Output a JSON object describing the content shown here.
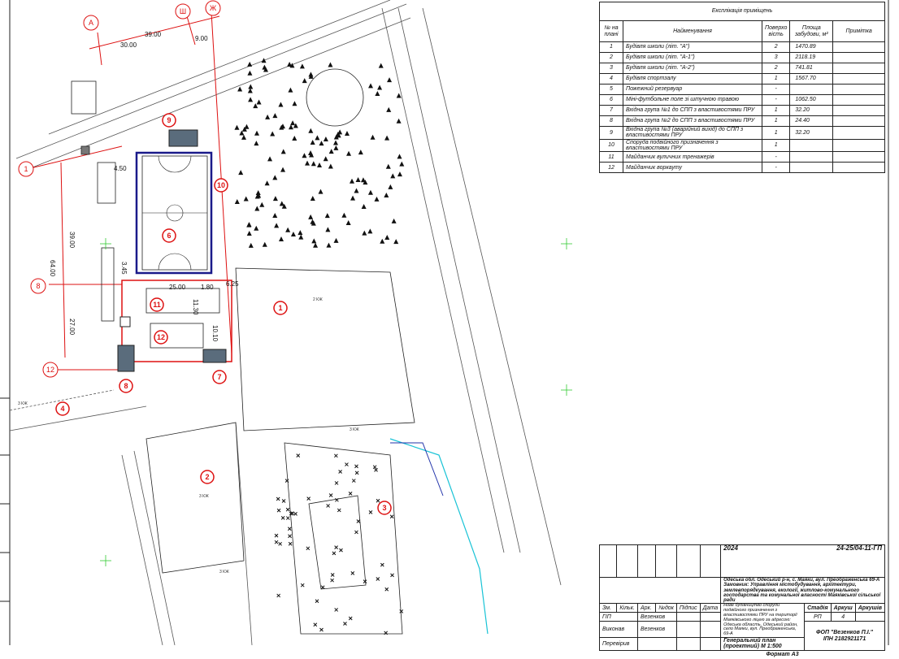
{
  "explication": {
    "title": "Експлікація приміщень",
    "headers": [
      "№ на плані",
      "Найменування",
      "Поверхо вість",
      "Площа забудови, м²",
      "Примітка"
    ],
    "rows": [
      {
        "n": "1",
        "name": "Будівля школи (літ. \"А\")",
        "floors": "2",
        "area": "1470.89",
        "note": ""
      },
      {
        "n": "2",
        "name": "Будівля школи (літ. \"А-1\")",
        "floors": "3",
        "area": "2118.19",
        "note": ""
      },
      {
        "n": "3",
        "name": "Будівля школи (літ. \"А-2\")",
        "floors": "2",
        "area": "741.81",
        "note": ""
      },
      {
        "n": "4",
        "name": "Будівля спортзалу",
        "floors": "1",
        "area": "1567.70",
        "note": ""
      },
      {
        "n": "5",
        "name": "Пожежний резервуар",
        "floors": "-",
        "area": "",
        "note": ""
      },
      {
        "n": "6",
        "name": "Міні-футбольне поле зі штучною травою",
        "floors": "-",
        "area": "1062.50",
        "note": ""
      },
      {
        "n": "7",
        "name": "Вхідна група №1 до СПП з властивостями ПРУ",
        "floors": "1",
        "area": "32.20",
        "note": ""
      },
      {
        "n": "8",
        "name": "Вхідна група №2 до СПП з властивостями ПРУ",
        "floors": "1",
        "area": "24.40",
        "note": ""
      },
      {
        "n": "9",
        "name": "Вхідна група №3 (аварійний вихід) до СПП з властивостями ПРУ",
        "floors": "1",
        "area": "32.20",
        "note": ""
      },
      {
        "n": "10",
        "name": "Споруда подвійного призначення з властивостями ПРУ",
        "floors": "1",
        "area": "",
        "note": ""
      },
      {
        "n": "11",
        "name": "Майданчик вуличних тренажерів",
        "floors": "-",
        "area": "",
        "note": ""
      },
      {
        "n": "12",
        "name": "Майданчик воркауту",
        "floors": "-",
        "area": "",
        "note": ""
      }
    ]
  },
  "stamp": {
    "year": "2024",
    "code": "24-25/04-11-ГП",
    "address": "Одеська обл. Одеський р-н, с. Маяки, вул. Преображенська 69-А",
    "customer": "Замовник: Управління містобудування, архітектури, землевпорядкування, екології, житлово-комунального господарства та комунальної власності Маяківської сільської ради",
    "col_headers": [
      "Зм.",
      "Кільк.",
      "Арк.",
      "№док",
      "Підпис",
      "Дата"
    ],
    "roles": [
      {
        "role": "ГІП",
        "name": "Везенков"
      },
      {
        "role": "Виконав",
        "name": "Везенков"
      },
      {
        "role": "Перевірив",
        "name": ""
      }
    ],
    "object": "Нове будівництво споруди подвійного призначення з властивостями ПРУ на території Маяківського ліцею за адресою: Одеська область, Одеський район, село Маяки, вул. Преображенська, 69-А",
    "stage_headers": [
      "Стадія",
      "Аркуш",
      "Аркушів"
    ],
    "stage": "РП",
    "sheet": "4",
    "sheets": "",
    "drawing": "Генеральний план (проектний) М 1:500",
    "company": "ФОП \"Везенков П.І.\"",
    "company_id": "ІПН 2182921171",
    "format": "Формат А3"
  },
  "plan": {
    "markers": [
      "1",
      "2",
      "3",
      "4",
      "6",
      "7",
      "8",
      "9",
      "10",
      "11",
      "12"
    ],
    "axes": [
      "А",
      "Ш",
      "Ж",
      "1",
      "8",
      "12"
    ],
    "dims": [
      "39.00",
      "30.00",
      "9.00",
      "4.50",
      "39.00",
      "64.00",
      "27.00",
      "3.45",
      "25.00",
      "1.80",
      "6.25",
      "11.30",
      "10.10"
    ],
    "labels": [
      "3 КЖ",
      "2 КЖ",
      "3 КЖ",
      "3 КЖ",
      "3 КЖ"
    ]
  }
}
